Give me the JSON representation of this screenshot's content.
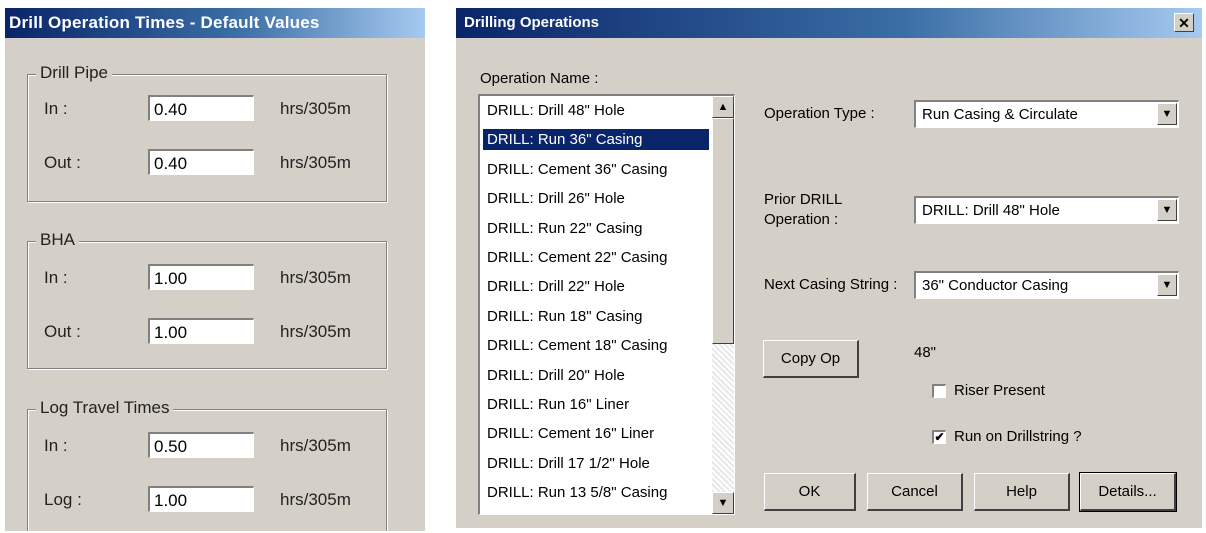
{
  "left": {
    "title": "Drill Operation Times - Default Values",
    "groups": [
      {
        "legend": "Drill Pipe",
        "rows": [
          {
            "label": "In :",
            "value": "0.40",
            "unit": "hrs/305m"
          },
          {
            "label": "Out :",
            "value": "0.40",
            "unit": "hrs/305m"
          }
        ]
      },
      {
        "legend": "BHA",
        "rows": [
          {
            "label": "In :",
            "value": "1.00",
            "unit": "hrs/305m"
          },
          {
            "label": "Out :",
            "value": "1.00",
            "unit": "hrs/305m"
          }
        ]
      },
      {
        "legend": "Log Travel Times",
        "rows": [
          {
            "label": "In :",
            "value": "0.50",
            "unit": "hrs/305m"
          },
          {
            "label": "Log :",
            "value": "1.00",
            "unit": "hrs/305m"
          }
        ]
      }
    ]
  },
  "dialog": {
    "title": "Drilling Operations",
    "close_glyph": "✕",
    "list_label": "Operation Name :",
    "operations": [
      "DRILL: Drill 48\" Hole",
      "DRILL: Run 36\" Casing",
      "DRILL: Cement 36\" Casing",
      "DRILL: Drill 26\" Hole",
      "DRILL: Run 22\" Casing",
      "DRILL: Cement 22\" Casing",
      "DRILL: Drill 22\" Hole",
      "DRILL: Run 18\" Casing",
      "DRILL: Cement 18\" Casing",
      "DRILL: Drill 20\" Hole",
      "DRILL: Run 16\" Liner",
      "DRILL: Cement 16\" Liner",
      "DRILL: Drill 17 1/2\" Hole",
      "DRILL: Run 13 5/8\" Casing"
    ],
    "selected_index": 1,
    "operation_type_label": "Operation Type :",
    "operation_type_value": "Run Casing & Circulate",
    "prior_label_line1": "Prior DRILL",
    "prior_label_line2": "Operation :",
    "prior_value": "DRILL: Drill 48\" Hole",
    "next_casing_label": "Next Casing String :",
    "next_casing_value": "36\" Conductor Casing",
    "copy_op_label": "Copy Op",
    "size_text": "48\"",
    "riser_label": "Riser Present",
    "riser_checked": false,
    "drillstring_label": "Run on Drillstring ?",
    "drillstring_checked": true,
    "ok_label": "OK",
    "cancel_label": "Cancel",
    "help_label": "Help",
    "details_label": "Details...",
    "up_arrow": "▲",
    "down_arrow": "▼",
    "check_glyph": "✔"
  }
}
